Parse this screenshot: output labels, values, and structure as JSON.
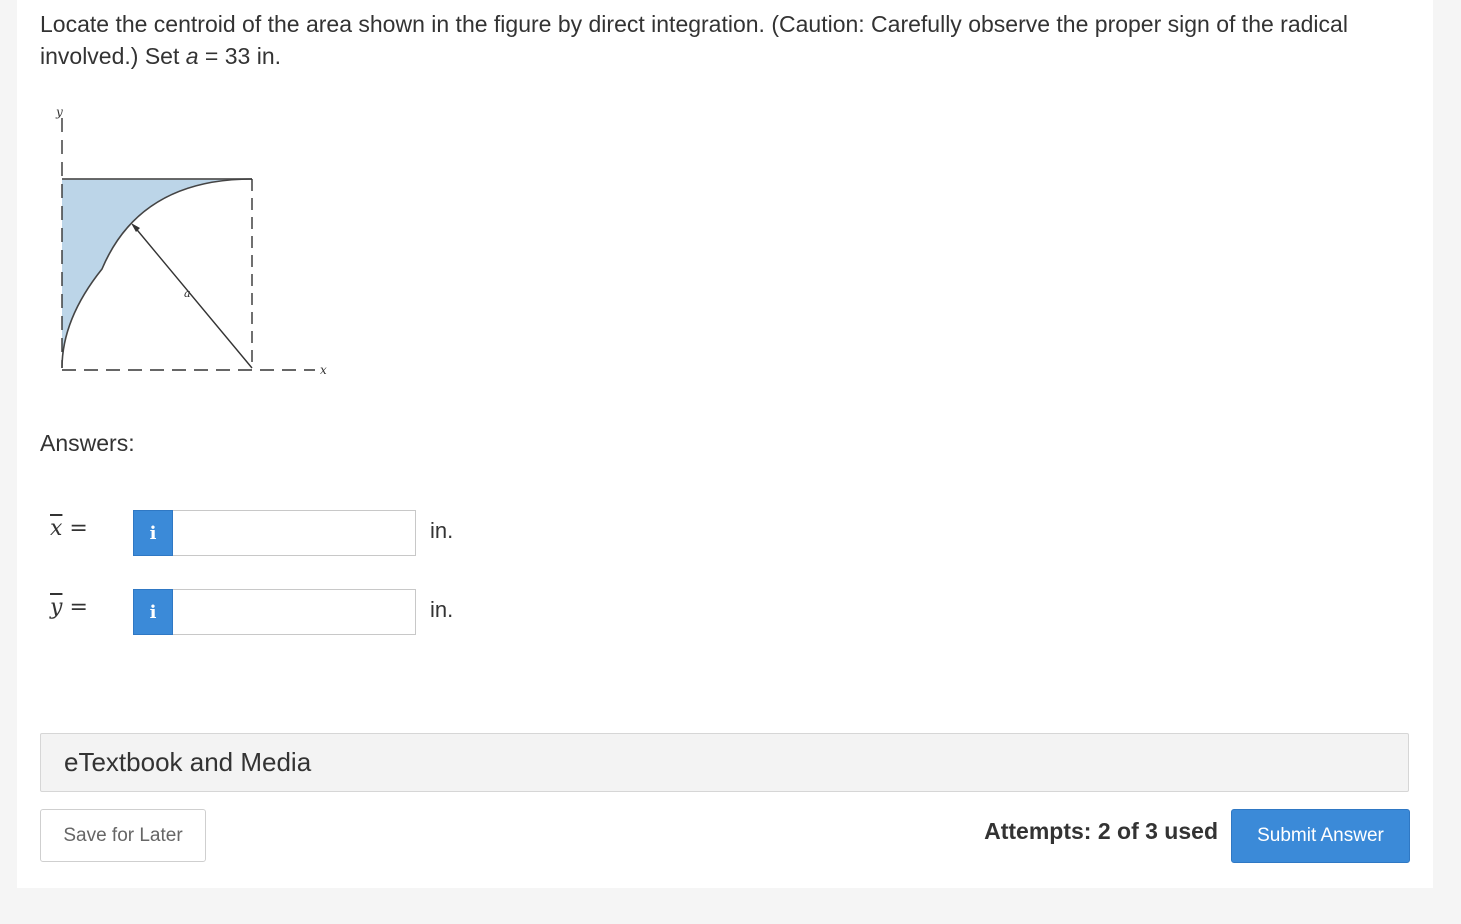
{
  "question": {
    "text_before": "Locate the centroid of the area shown in the figure by direct integration. (Caution: Carefully observe the proper sign of the radical involved.) Set ",
    "variable": "a",
    "text_after": " = 33 in."
  },
  "figure": {
    "y_axis_label": "y",
    "x_axis_label": "x",
    "radius_label": "a",
    "fill_color": "#bcd5e8"
  },
  "answers": {
    "heading": "Answers:",
    "rows": [
      {
        "symbol": "x",
        "equals": "=",
        "info_icon": "i",
        "value": "",
        "unit": "in."
      },
      {
        "symbol": "y",
        "equals": "=",
        "info_icon": "i",
        "value": "",
        "unit": "in."
      }
    ]
  },
  "etextbook": {
    "label": "eTextbook and Media"
  },
  "footer": {
    "save_label": "Save for Later",
    "attempts": "Attempts: 2 of 3 used",
    "submit_label": "Submit Answer"
  },
  "colors": {
    "accent": "#3b8ad8"
  }
}
